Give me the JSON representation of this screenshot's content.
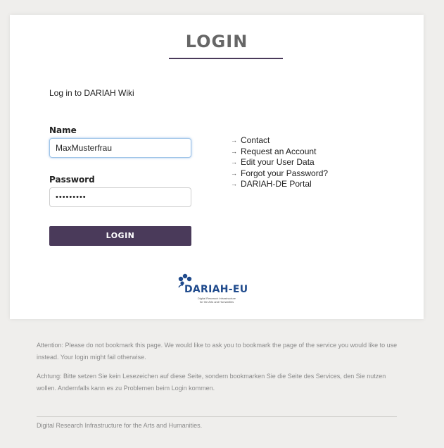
{
  "login": {
    "title": "LOGIN",
    "intro": "Log in to DARIAH Wiki",
    "name_label": "Name",
    "name_value": "MaxMusterfrau",
    "password_label": "Password",
    "password_value": "•••••••••",
    "button_label": "LOGIN"
  },
  "links": [
    {
      "label": "Contact"
    },
    {
      "label": "Request an Account"
    },
    {
      "label": "Edit your User Data"
    },
    {
      "label": "Forgot your Password?"
    },
    {
      "label": "DARIAH-DE Portal"
    }
  ],
  "link_arrow": "→",
  "logo": {
    "name": "DARIAH-EU",
    "subtitle_line1": "Digital Research Infrastructure",
    "subtitle_line2": "for the Arts and Humanities"
  },
  "notices": {
    "en": "Attention: Please do not bookmark this page. We would like to ask you to bookmark the page of the service you would like to use instead. Your login might fail otherwise.",
    "de": "Achtung: Bitte setzen Sie kein Lesezeichen auf diese Seite, sondern bookmarken Sie die Seite des Services, den Sie nutzen wollen. Andernfalls kann es zu Problemen beim Login kommen."
  },
  "footer": "Digital Research Infrastructure for the Arts and Humanities.",
  "colors": {
    "accent": "#4a3a5a",
    "logo_blue": "#1f4a8c",
    "background": "#efeeec"
  }
}
